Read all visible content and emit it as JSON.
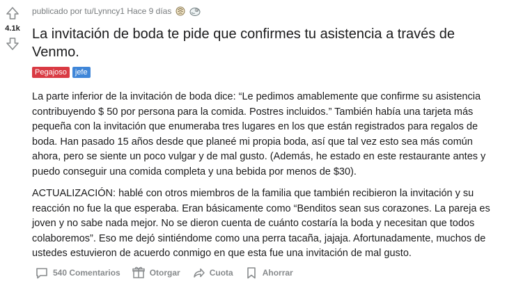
{
  "post": {
    "meta": "publicado por tu/Lynncy1 Hace 9 días",
    "score": "4.1k",
    "title": "La invitación de boda te pide que confirmes tu asistencia a través de Venmo.",
    "flairs": [
      "Pegajoso",
      "jefe"
    ],
    "paragraphs": [
      "La parte inferior de la invitación de boda dice: “Le pedimos amablemente que confirme su asistencia contribuyendo $ 50 por persona para la comida. Postres incluidos.” También había una tarjeta más pequeña con la invitación que enumeraba tres lugares en los que están registrados para regalos de boda. Han pasado 15 años desde que planeé mi propia boda, así que tal vez esto sea más común ahora, pero se siente un poco vulgar y de mal gusto. (Además, he estado en este restaurante antes y puedo conseguir una comida completa y una bebida por menos de $30).",
      "ACTUALIZACIÓN: hablé con otros miembros de la familia que también recibieron la invitación y su reacción no fue la que esperaba. Eran básicamente como “Benditos sean sus corazones. La pareja es joven y no sabe nada mejor. No se dieron cuenta de cuánto costaría la boda y necesitan que todos colaboremos”. Eso me dejó sintiéndome como una perra tacaña, jajaja. Afortunadamente, muchos de ustedes estuvieron de acuerdo conmigo en que esta fue una invitación de mal gusto."
    ]
  },
  "actions": {
    "comments": "540 Comentarios",
    "give": "Otorgar",
    "share": "Cuota",
    "save": "Ahorrar"
  },
  "colors": {
    "flair_red": "#d93a43",
    "flair_blue": "#3f86d8",
    "muted": "#878a8c"
  }
}
